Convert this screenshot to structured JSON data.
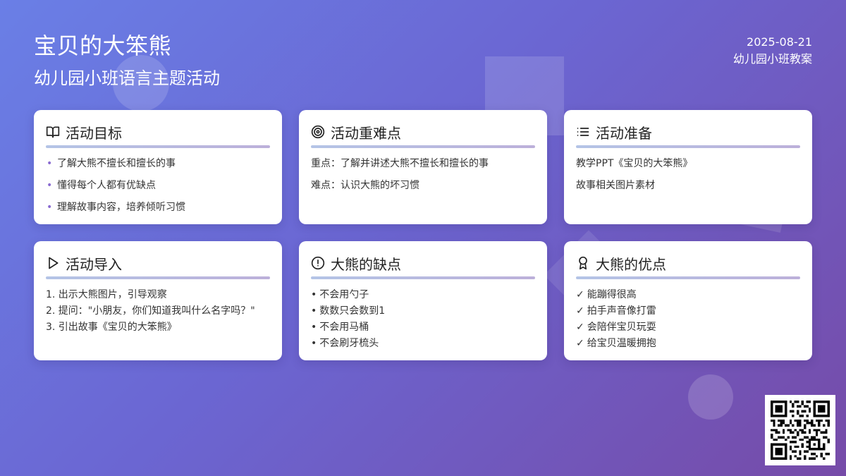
{
  "header": {
    "title": "宝贝的大笨熊",
    "subtitle": "幼儿园小班语言主题活动",
    "date": "2025-08-21",
    "doc_type": "幼儿园小班教案"
  },
  "cards": {
    "goals": {
      "title": "活动目标",
      "icon": "book-open-icon",
      "items": [
        "了解大熊不擅长和擅长的事",
        "懂得每个人都有优缺点",
        "理解故事内容，培养倾听习惯"
      ]
    },
    "keypoints": {
      "title": "活动重难点",
      "icon": "target-icon",
      "items": [
        "重点：了解并讲述大熊不擅长和擅长的事",
        "难点：认识大熊的坏习惯"
      ]
    },
    "prep": {
      "title": "活动准备",
      "icon": "list-icon",
      "items": [
        "教学PPT《宝贝的大笨熊》",
        "故事相关图片素材"
      ]
    },
    "intro": {
      "title": "活动导入",
      "icon": "play-icon",
      "items": [
        "1. 出示大熊图片，引导观察",
        "2. 提问：\"小朋友，你们知道我叫什么名字吗？\"",
        "3. 引出故事《宝贝的大笨熊》"
      ]
    },
    "weakness": {
      "title": "大熊的缺点",
      "icon": "alert-circle-icon",
      "marker": "•",
      "items": [
        "不会用勺子",
        "数数只会数到1",
        "不会用马桶",
        "不会刷牙梳头"
      ]
    },
    "strength": {
      "title": "大熊的优点",
      "icon": "award-icon",
      "marker": "✓",
      "items": [
        "能蹦得很高",
        "拍手声音像打雷",
        "会陪伴宝贝玩耍",
        "给宝贝温暖拥抱"
      ]
    }
  },
  "qr_code": {
    "icon": "qr-code"
  }
}
